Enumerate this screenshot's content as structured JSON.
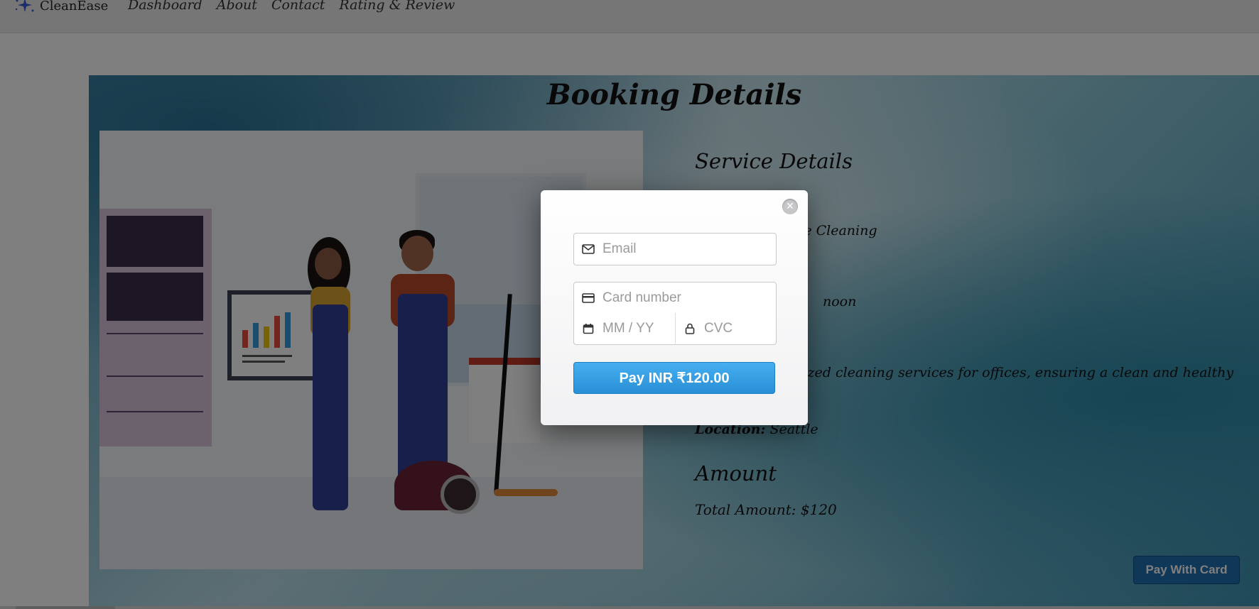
{
  "nav": {
    "brand": "CleanEase",
    "links": [
      "Dashboard",
      "About",
      "Contact",
      "Rating & Review"
    ]
  },
  "page": {
    "title": "Booking Details"
  },
  "service": {
    "heading": "Service Details",
    "service_fragment": "fice Cleaning",
    "time_fragment": "noon",
    "description_fragment": "alized cleaning services for offices, ensuring a clean and healthy",
    "location_label": "Location:",
    "location_value": "Seattle"
  },
  "amount": {
    "heading": "Amount",
    "total": "Total Amount: $120"
  },
  "actions": {
    "pay_with_card": "Pay With Card"
  },
  "checkout": {
    "email_placeholder": "Email",
    "card_placeholder": "Card number",
    "expiry_placeholder": "MM / YY",
    "cvc_placeholder": "CVC",
    "pay_button": "Pay INR ₹120.00",
    "close": "✕"
  },
  "icons": [
    "sparkle-logo-icon",
    "mail-icon",
    "card-icon",
    "calendar-icon",
    "lock-icon",
    "close-icon"
  ],
  "colors": {
    "accent": "#2a8fd6",
    "pay_with_card_bg": "#1e6fb0"
  }
}
